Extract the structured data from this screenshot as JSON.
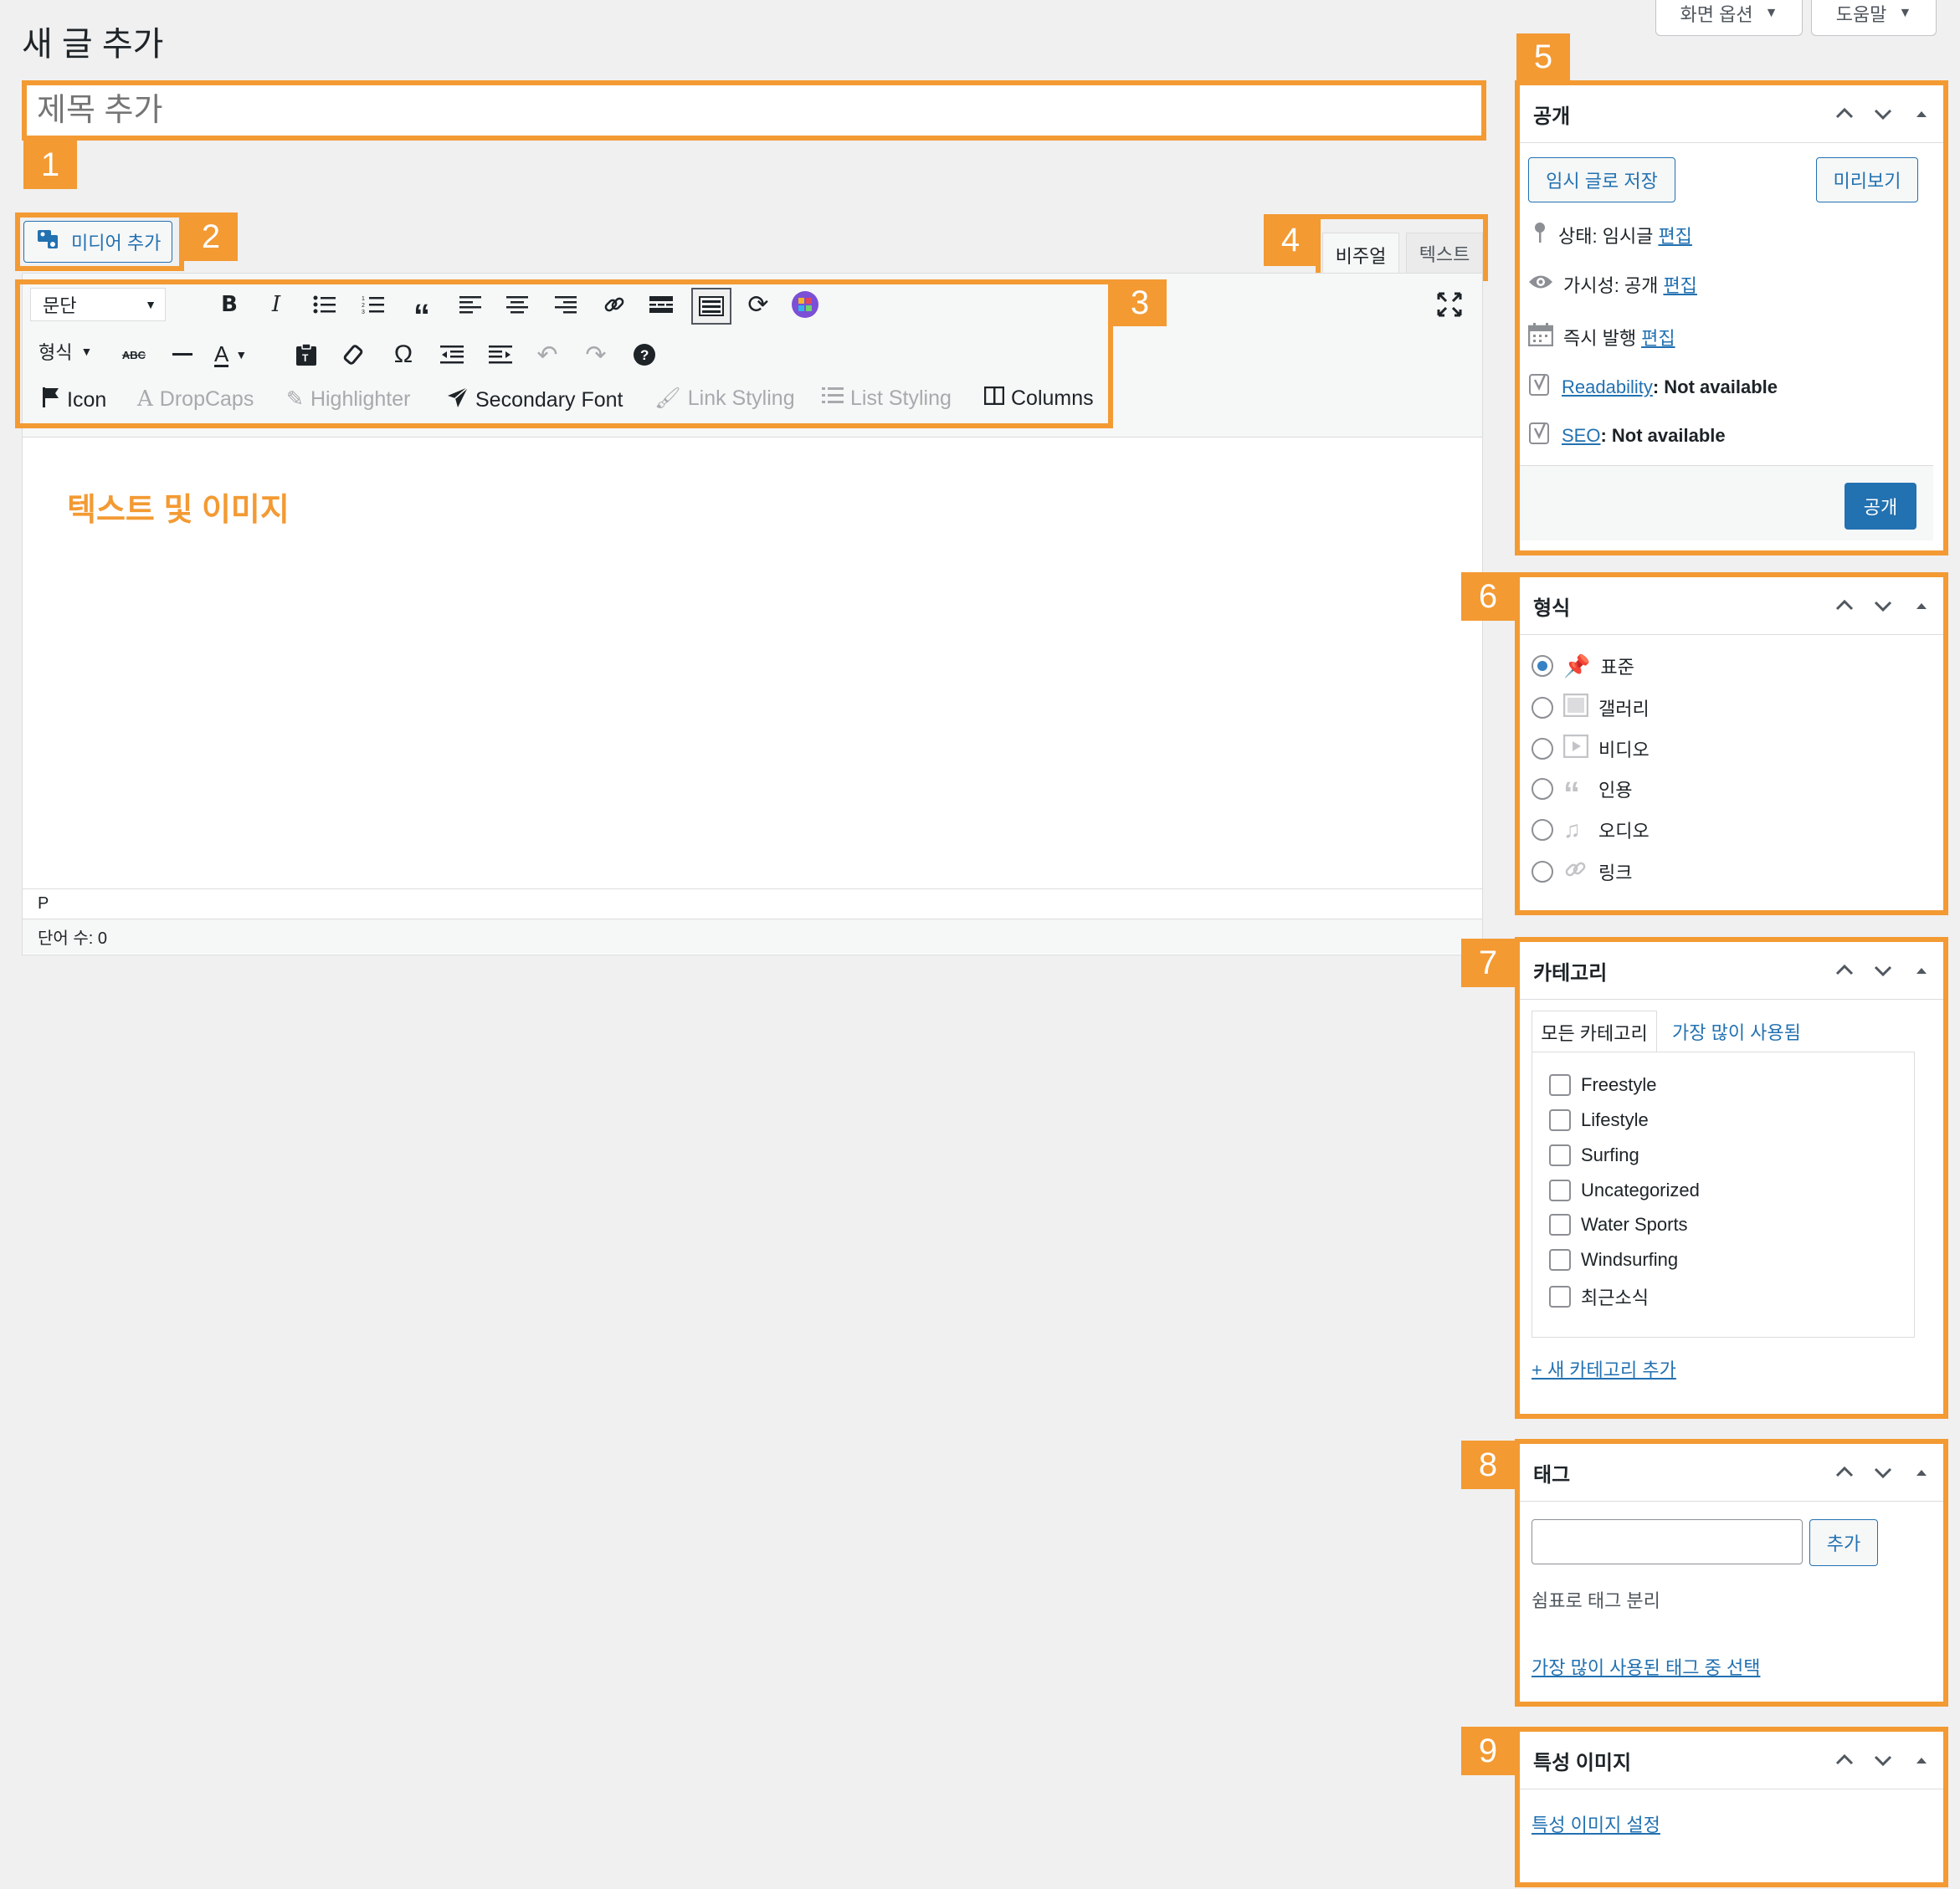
{
  "page": {
    "title": "새 글 추가",
    "screen_options": "화면 옵션",
    "help": "도움말"
  },
  "callouts": [
    "1",
    "2",
    "3",
    "4",
    "5",
    "6",
    "7",
    "8",
    "9"
  ],
  "accent_color": "#f39a33",
  "title_input": {
    "placeholder": "제목 추가"
  },
  "media_button": {
    "label": "미디어 추가"
  },
  "editor_tabs": {
    "visual": "비주얼",
    "text": "텍스트"
  },
  "toolbar": {
    "format_select": "문단",
    "styles_select": "형식",
    "row1_icons": [
      "bold-icon",
      "italic-icon",
      "bullet-list-icon",
      "numbered-list-icon",
      "blockquote-icon",
      "align-left-icon",
      "align-center-icon",
      "align-right-icon",
      "link-icon",
      "read-more-icon",
      "toolbar-toggle-icon",
      "refresh-icon",
      "plugin-grid-icon"
    ],
    "row2_icons": [
      "strikethrough-icon",
      "horizontal-line-icon",
      "text-color-icon",
      "paste-text-icon",
      "clear-format-icon",
      "special-char-icon",
      "outdent-icon",
      "indent-icon",
      "undo-icon",
      "redo-icon",
      "help-icon"
    ],
    "plugins": [
      {
        "label": "Icon",
        "enabled": true
      },
      {
        "label": "DropCaps",
        "enabled": false
      },
      {
        "label": "Highlighter",
        "enabled": false
      },
      {
        "label": "Secondary Font",
        "enabled": true
      },
      {
        "label": "Link Styling",
        "enabled": false
      },
      {
        "label": "List Styling",
        "enabled": false
      },
      {
        "label": "Columns",
        "enabled": true
      }
    ]
  },
  "editor": {
    "content_label": "텍스트 및 이미지",
    "path": "P",
    "word_count": "단어 수: 0"
  },
  "publish": {
    "title": "공개",
    "save_draft": "임시 글로 저장",
    "preview": "미리보기",
    "status_label": "상태: 임시글",
    "visibility_label": "가시성: 공개",
    "schedule_label": "즉시 발행",
    "edit": "편집",
    "readability_link": "Readability",
    "readability_value": ": Not available",
    "seo_link": "SEO",
    "seo_value": ": Not available",
    "publish_button": "공개"
  },
  "format": {
    "title": "형식",
    "options": [
      {
        "label": "표준",
        "icon": "pin-icon",
        "selected": true
      },
      {
        "label": "갤러리",
        "icon": "gallery-icon",
        "selected": false
      },
      {
        "label": "비디오",
        "icon": "video-icon",
        "selected": false
      },
      {
        "label": "인용",
        "icon": "quote-icon",
        "selected": false
      },
      {
        "label": "오디오",
        "icon": "audio-icon",
        "selected": false
      },
      {
        "label": "링크",
        "icon": "link-icon",
        "selected": false
      }
    ]
  },
  "categories": {
    "title": "카테고리",
    "tab_all": "모든 카테고리",
    "tab_popular": "가장 많이 사용됨",
    "items": [
      "Freestyle",
      "Lifestyle",
      "Surfing",
      "Uncategorized",
      "Water Sports",
      "Windsurfing",
      "최근소식"
    ],
    "add_new": "+ 새 카테고리 추가"
  },
  "tags": {
    "title": "태그",
    "add_button": "추가",
    "hint": "쉼표로 태그 분리",
    "choose_link": "가장 많이 사용된 태그 중 선택"
  },
  "featured": {
    "title": "특성 이미지",
    "set_link": "특성 이미지 설정"
  }
}
